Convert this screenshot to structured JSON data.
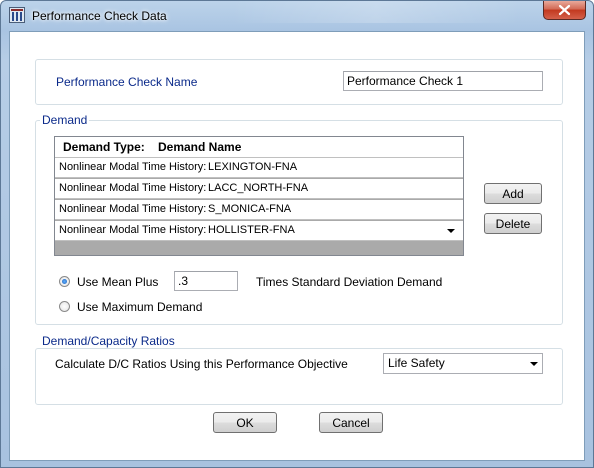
{
  "window": {
    "title": "Performance Check Data"
  },
  "check_name": {
    "label": "Performance Check Name",
    "value": "Performance Check 1"
  },
  "demand": {
    "group_label": "Demand",
    "columns": [
      "Demand Type:",
      "Demand Name"
    ],
    "rows": [
      {
        "type": "Nonlinear Modal Time History:",
        "name": "LEXINGTON-FNA"
      },
      {
        "type": "Nonlinear Modal Time History:",
        "name": "LACC_NORTH-FNA"
      },
      {
        "type": "Nonlinear Modal Time History:",
        "name": "S_MONICA-FNA"
      },
      {
        "type": "Nonlinear Modal Time History:",
        "name": "HOLLISTER-FNA"
      }
    ],
    "add_label": "Add",
    "delete_label": "Delete",
    "use_mean_plus_label": "Use Mean Plus",
    "mean_plus_value": ".3",
    "times_std_label": "Times Standard Deviation Demand",
    "use_max_label": "Use Maximum Demand",
    "selected_option": "Use Mean Plus"
  },
  "dc_ratios": {
    "group_label": "Demand/Capacity Ratios",
    "calc_label": "Calculate D/C Ratios Using this Performance Objective",
    "objective_value": "Life Safety"
  },
  "footer": {
    "ok_label": "OK",
    "cancel_label": "Cancel"
  },
  "colors": {
    "accent_label": "#0b2a8a",
    "close_button": "#c2391f"
  }
}
